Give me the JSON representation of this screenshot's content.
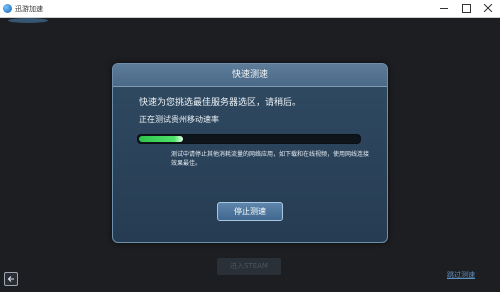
{
  "window": {
    "title": "迅游加速"
  },
  "dialog": {
    "title": "快速测速",
    "message": "快速为您挑选最佳服务器选区，请稍后。",
    "status": "正在测试贵州移动速率",
    "progress": 0.2,
    "hint": "测试中请停止其他消耗流量的网络应用，如下载和在线视频，使用网线连接效果最佳。",
    "stop_label": "停止测速"
  },
  "footer": {
    "enter_label": "进入STEAM",
    "corner_link": "跳过测速"
  }
}
